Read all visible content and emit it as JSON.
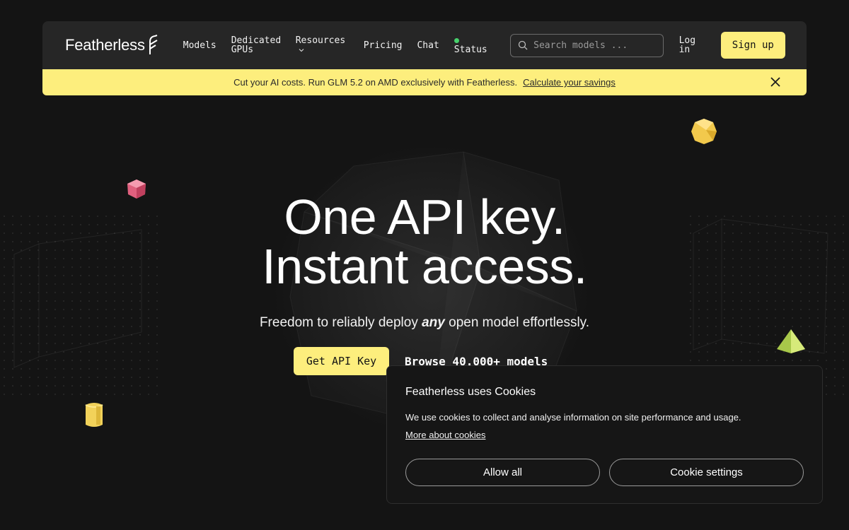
{
  "brand": {
    "name": "Featherless"
  },
  "nav": {
    "models": "Models",
    "dedicated_gpus": "Dedicated GPUs",
    "resources": "Resources",
    "pricing": "Pricing",
    "chat": "Chat",
    "status": "Status",
    "search_placeholder": "Search models ...",
    "login": "Log in",
    "signup": "Sign up"
  },
  "banner": {
    "text": "Cut your AI costs. Run GLM 5.2 on AMD exclusively with Featherless.",
    "link": "Calculate your savings"
  },
  "hero": {
    "title_line1": "One API key.",
    "title_line2": "Instant access.",
    "sub_before": "Freedom to reliably deploy ",
    "sub_em": "any",
    "sub_after": " open model effortlessly.",
    "cta_primary": "Get API Key",
    "cta_secondary": "Browse 40.000+ models"
  },
  "cookie": {
    "title": "Featherless uses Cookies",
    "text": "We use cookies to collect and analyse information on site performance and usage.",
    "link": "More about cookies",
    "allow_all": "Allow all",
    "settings": "Cookie settings"
  },
  "colors": {
    "accent": "#fdee7d",
    "background": "#141414",
    "nav_bg": "#262626",
    "status": "#47d16c"
  }
}
